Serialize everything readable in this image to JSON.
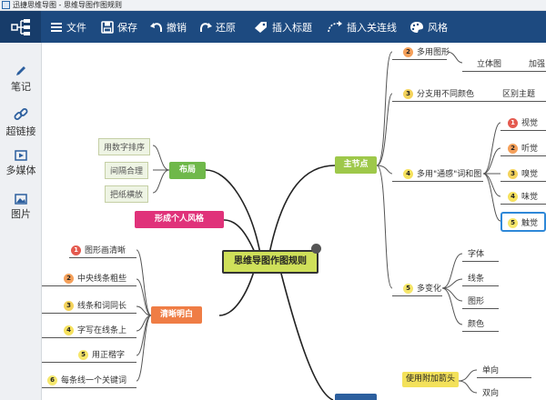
{
  "window": {
    "title": "迅捷思维导图 - 思维导图作图规则"
  },
  "toolbar": {
    "file": "文件",
    "save": "保存",
    "undo": "撤销",
    "redo": "还原",
    "insert_title": "插入标题",
    "insert_link": "插入关连线",
    "style": "风格"
  },
  "sidebar": {
    "items": [
      {
        "label": "笔记"
      },
      {
        "label": "超链接"
      },
      {
        "label": "多媒体"
      },
      {
        "label": "图片"
      }
    ]
  },
  "mindmap": {
    "center": "思维导图作图规则",
    "main_node": "主节点",
    "layout": "布局",
    "layout_items": [
      "用数字排序",
      "间隔合理",
      "把纸横放"
    ],
    "style_node": "形成个人风格",
    "clear_node": "清晰明白",
    "clear_items": [
      {
        "num": "1",
        "text": "图形画清晰"
      },
      {
        "num": "2",
        "text": "中央线条粗些"
      },
      {
        "num": "3",
        "text": "线条和词同长"
      },
      {
        "num": "4",
        "text": "字写在线条上"
      },
      {
        "num": "5",
        "text": "用正楷字"
      },
      {
        "num": "6",
        "text": "每条线一个关键词"
      }
    ],
    "right": {
      "item2": {
        "num": "2",
        "text": "多用图形",
        "sub": "立体图",
        "sub2": "加强"
      },
      "item3": {
        "num": "3",
        "text": "分支用不同颜色",
        "sub": "区别主题"
      },
      "item4": {
        "num": "4",
        "text": "多用\"通感\"词和图",
        "senses": [
          {
            "num": "1",
            "text": "视觉"
          },
          {
            "num": "2",
            "text": "听觉"
          },
          {
            "num": "3",
            "text": "嗅觉"
          },
          {
            "num": "4",
            "text": "味觉"
          },
          {
            "num": "5",
            "text": "触觉"
          }
        ]
      },
      "item5": {
        "num": "5",
        "text": "多变化",
        "subs": [
          "字体",
          "线条",
          "图形",
          "颜色"
        ]
      },
      "arrow_node": "使用附加箭头",
      "arrow_subs": [
        "单向",
        "双向"
      ]
    }
  },
  "colors": {
    "toolbar_bg": "#1d4a80",
    "main_node": "#9ec84a",
    "layout_node": "#6fb84a",
    "style_node": "#e0327a",
    "clear_node": "#ef7d45",
    "center_node": "#cfe05a",
    "arrow_node": "#f3e15a"
  }
}
